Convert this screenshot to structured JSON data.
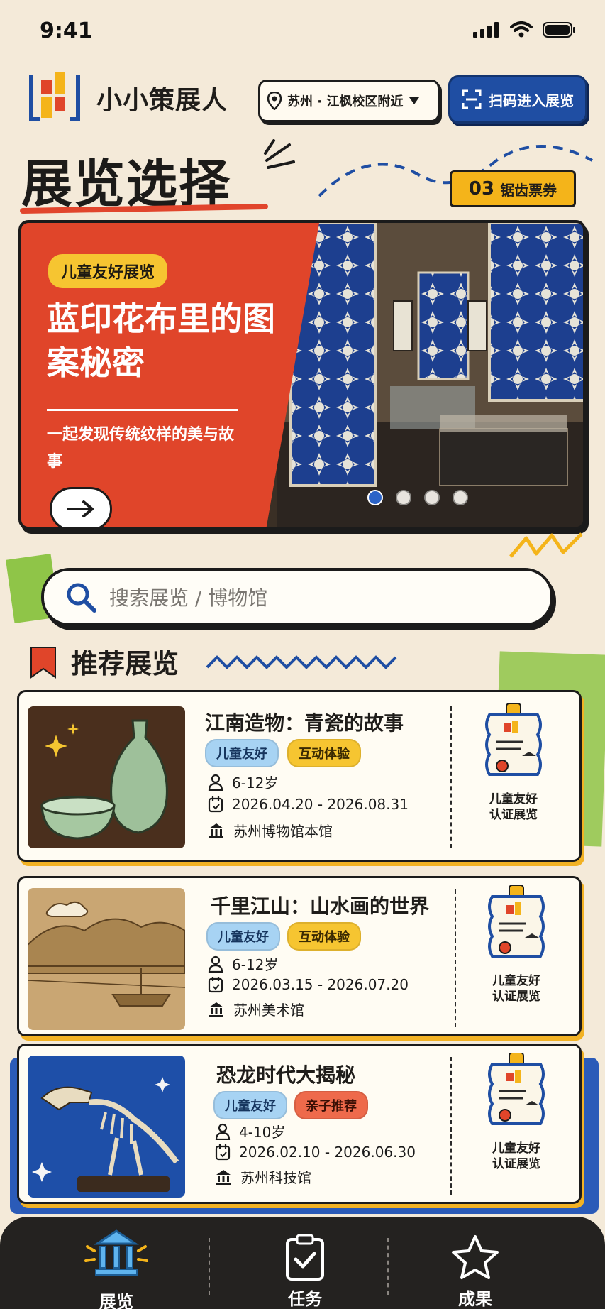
{
  "status_bar": {
    "time": "9:41"
  },
  "header": {
    "app_name": "小小策展人",
    "location": "苏州 · 江枫校区附近",
    "scan_button": "扫码进入展览"
  },
  "page_title": "展览选择",
  "ticket_badge": {
    "count": "03",
    "label": "锯齿票券"
  },
  "hero": {
    "tag": "儿童友好展览",
    "title": "蓝印花布里的图案秘密",
    "subtitle": "一起发现传统纹样的美与故事",
    "dots_total": 4,
    "dots_active": 1
  },
  "search": {
    "placeholder": "搜索展览 / 博物馆"
  },
  "section": {
    "title": "推荐展览"
  },
  "cards": [
    {
      "title": "江南造物：青瓷的故事",
      "tags": [
        "儿童友好",
        "互动体验"
      ],
      "age": "6-12岁",
      "dates": "2026.04.20 - 2026.08.31",
      "venue": "苏州博物馆本馆",
      "cert_line1": "儿童友好",
      "cert_line2": "认证展览"
    },
    {
      "title": "千里江山：山水画的世界",
      "tags": [
        "儿童友好",
        "互动体验"
      ],
      "age": "6-12岁",
      "dates": "2026.03.15 - 2026.07.20",
      "venue": "苏州美术馆",
      "cert_line1": "儿童友好",
      "cert_line2": "认证展览"
    },
    {
      "title": "恐龙时代大揭秘",
      "tags": [
        "儿童友好",
        "亲子推荐"
      ],
      "age": "4-10岁",
      "dates": "2026.02.10 - 2026.06.30",
      "venue": "苏州科技馆",
      "cert_line1": "儿童友好",
      "cert_line2": "认证展览"
    }
  ],
  "nav": {
    "items": [
      {
        "label": "展览",
        "icon": "museum-icon",
        "active": true
      },
      {
        "label": "任务",
        "icon": "clipboard-check-icon",
        "active": false
      },
      {
        "label": "成果",
        "icon": "star-icon",
        "active": false
      }
    ]
  },
  "colors": {
    "background": "#f4ead9",
    "accent_red": "#e0452a",
    "accent_blue": "#1f4ea3",
    "accent_yellow": "#f4b41a",
    "nav_bg": "#242220"
  }
}
